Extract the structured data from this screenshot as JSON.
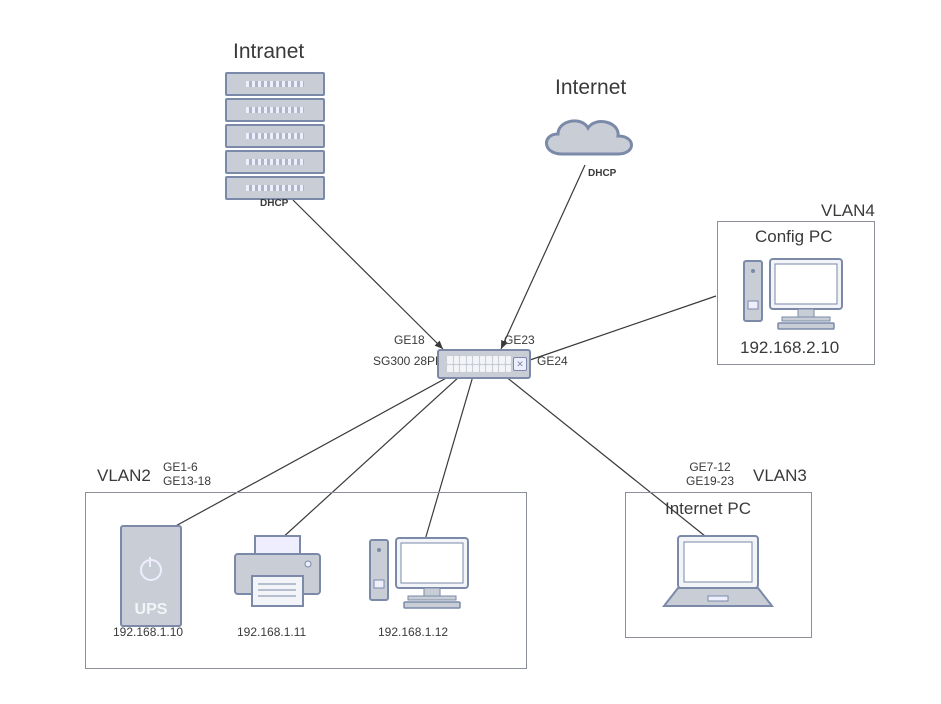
{
  "intranet": {
    "title": "Intranet",
    "proto": "DHCP"
  },
  "internet": {
    "title": "Internet",
    "proto": "DHCP"
  },
  "switch": {
    "model": "SG300 28PP",
    "ports": {
      "intranet": "GE18",
      "internet": "GE23",
      "config": "GE24"
    }
  },
  "vlan4": {
    "name": "VLAN4",
    "device": "Config PC",
    "ip": "192.168.2.10"
  },
  "vlan3": {
    "name": "VLAN3",
    "ports": "GE7-12\nGE19-23",
    "device": "Internet PC"
  },
  "vlan2": {
    "name": "VLAN2",
    "ports": "GE1-6\nGE13-18",
    "devices": [
      {
        "kind": "ups",
        "ip": "192.168.1.10",
        "label": "UPS"
      },
      {
        "kind": "printer",
        "ip": "192.168.1.11"
      },
      {
        "kind": "pc",
        "ip": "192.168.1.12"
      }
    ]
  }
}
